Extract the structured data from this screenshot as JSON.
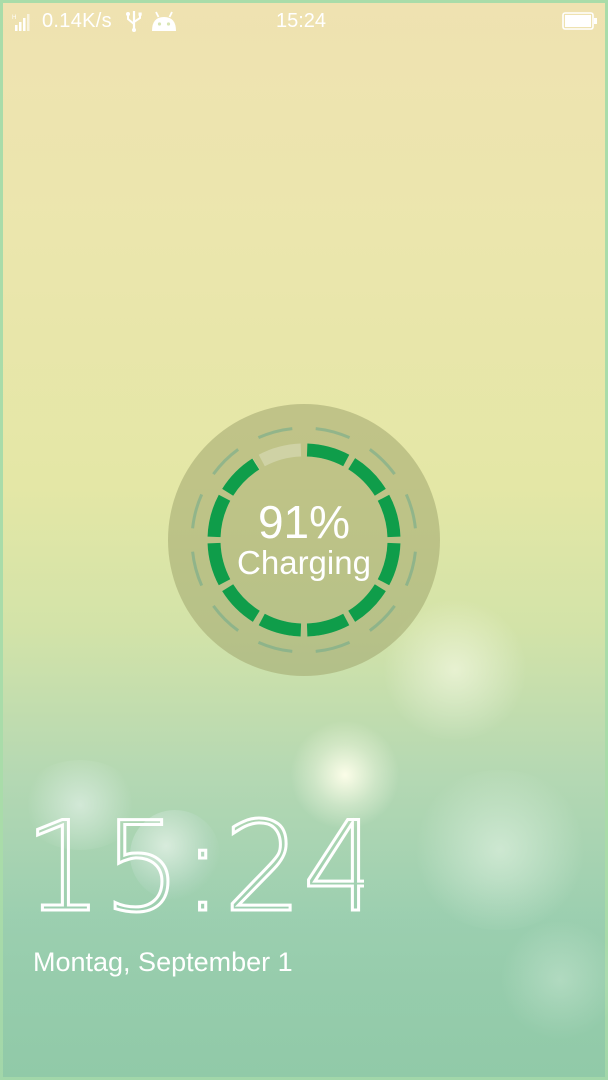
{
  "status_bar": {
    "net_speed": "0.14K/s",
    "time": "15:24",
    "icons": [
      "signal-icon",
      "usb-icon",
      "android-icon",
      "battery-icon"
    ]
  },
  "charging": {
    "percent_label": "91%",
    "percent_value": 91,
    "status_label": "Charging",
    "ring_color": "#0f9d4a"
  },
  "lockscreen": {
    "clock": "15:24",
    "date": "Montag, September 1"
  }
}
